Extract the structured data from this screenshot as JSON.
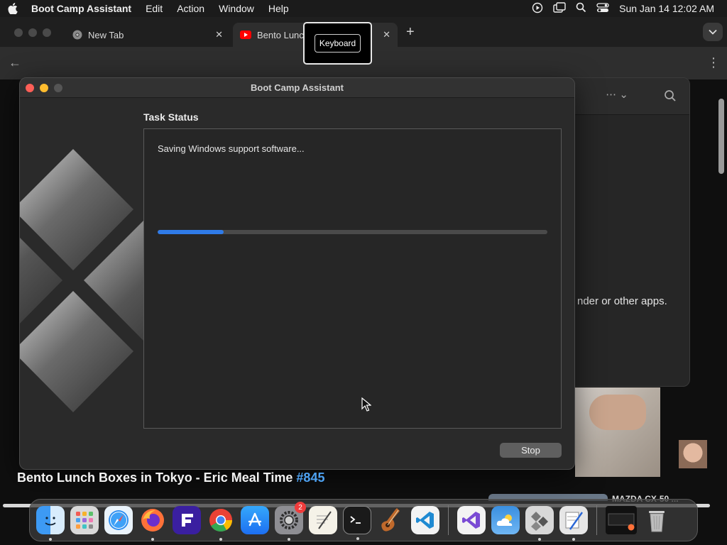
{
  "menubar": {
    "app_name": "Boot Camp Assistant",
    "menus": [
      "Edit",
      "Action",
      "Window",
      "Help"
    ],
    "clock": "Sun Jan 14  12:02 AM"
  },
  "browser": {
    "tabs": [
      {
        "label": "New Tab"
      },
      {
        "label": "Bento Lunc"
      }
    ],
    "video_title": "Bento Lunch Boxes in Tokyo - Eric Meal Time",
    "video_hashtag": "#845",
    "next_video_title": "MAZDA CX-50 ...",
    "side_text": "nder or other apps."
  },
  "tooltip": {
    "label": "Keyboard"
  },
  "bootcamp": {
    "window_title": "Boot Camp Assistant",
    "heading": "Task Status",
    "status_text": "Saving Windows support software...",
    "progress_fraction": 0.17,
    "stop_label": "Stop"
  },
  "dock": {
    "settings_badge": "2",
    "apps": [
      "finder-icon",
      "launchpad-icon",
      "safari-icon",
      "firefox-icon",
      "fences-icon",
      "chrome-icon",
      "app-store-icon",
      "system-settings-icon",
      "textedit-icon",
      "terminal-icon",
      "garageband-icon",
      "vscode-icon",
      "visual-studio-icon",
      "weather-icon",
      "boot-camp-icon",
      "script-editor-icon",
      "screenshot-icon",
      "trash-icon"
    ]
  },
  "colors": {
    "accent": "#2f7be8",
    "hashtag": "#4ea2f2",
    "close": "#fe5f57",
    "minimize": "#febc2e"
  }
}
